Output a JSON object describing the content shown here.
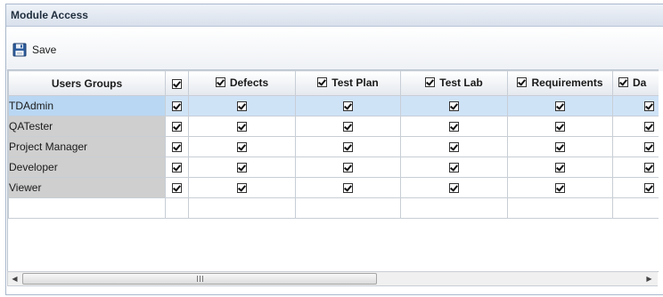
{
  "panel": {
    "title": "Module Access"
  },
  "toolbar": {
    "save_label": "Save",
    "save_icon": "floppy-disk-icon"
  },
  "grid": {
    "group_header": "Users Groups",
    "columns": [
      "",
      "Defects",
      "Test Plan",
      "Test Lab",
      "Requirements",
      "Da"
    ],
    "rows": [
      {
        "name": "TDAdmin",
        "selected": true,
        "checks": [
          true,
          true,
          true,
          true,
          true,
          true
        ]
      },
      {
        "name": "QATester",
        "selected": false,
        "checks": [
          true,
          true,
          true,
          true,
          true,
          true
        ]
      },
      {
        "name": "Project Manager",
        "selected": false,
        "checks": [
          true,
          true,
          true,
          true,
          true,
          true
        ]
      },
      {
        "name": "Developer",
        "selected": false,
        "checks": [
          true,
          true,
          true,
          true,
          true,
          true
        ]
      },
      {
        "name": "Viewer",
        "selected": false,
        "checks": [
          true,
          true,
          true,
          true,
          true,
          true
        ]
      }
    ]
  },
  "colors": {
    "selected_row": "#cfe3f7",
    "group_cell": "#cfcfcf",
    "title_bar": "#d9e1ec"
  }
}
